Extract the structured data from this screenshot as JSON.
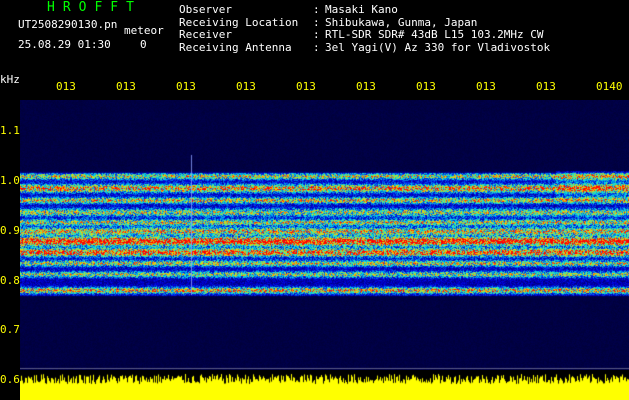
{
  "header": {
    "app_title": "HROFFT",
    "file_name": "UT2508290130.pn",
    "mode": "meteor",
    "datetime": "25.08.29 01:30",
    "counter": "0"
  },
  "info": [
    {
      "label": "Observer",
      "value": "Masaki Kano"
    },
    {
      "label": "Receiving Location",
      "value": "Shibukawa, Gunma, Japan"
    },
    {
      "label": "Receiver",
      "value": "RTL-SDR SDR# 43dB L15 103.2MHz CW"
    },
    {
      "label": "Receiving Antenna",
      "value": "3el Yagi(V) Az 330 for Vladivostok"
    }
  ],
  "axis": {
    "unit": "kHz",
    "time_labels": [
      "013",
      "013",
      "013",
      "013",
      "013",
      "013",
      "013",
      "013",
      "013",
      "0140"
    ],
    "freq_labels": [
      "1.1",
      "1.0",
      "0.9",
      "0.8",
      "0.7",
      "0.6"
    ],
    "separator": ":"
  },
  "colors": {
    "title": "#00ff00",
    "time_labels": "#ffff00",
    "freq_labels": "#ffff00",
    "level_bar": "#ffff00",
    "background": "#000030"
  }
}
